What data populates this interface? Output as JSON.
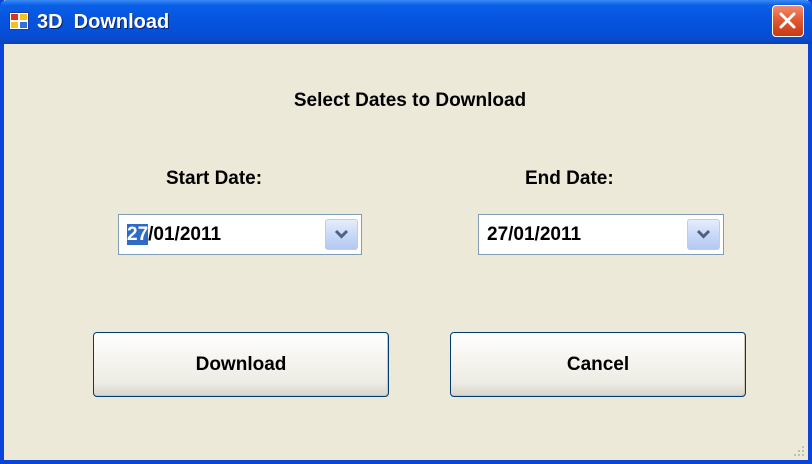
{
  "window": {
    "title": "3D  Download",
    "icon": "application-window-icon",
    "close_icon": "close-icon"
  },
  "dialog": {
    "heading": "Select Dates to Download",
    "start": {
      "label": "Start Date:",
      "value_selected": "27",
      "value_rest": "/01/2011",
      "dropdown_icon": "chevron-down-icon"
    },
    "end": {
      "label": "End Date:",
      "value": "27/01/2011",
      "dropdown_icon": "chevron-down-icon"
    },
    "buttons": {
      "download": "Download",
      "cancel": "Cancel"
    }
  },
  "colors": {
    "title_bar": "#0655e0",
    "close_button": "#e05a34",
    "dialog_bg": "#ece9d8",
    "selection": "#316ac5"
  }
}
